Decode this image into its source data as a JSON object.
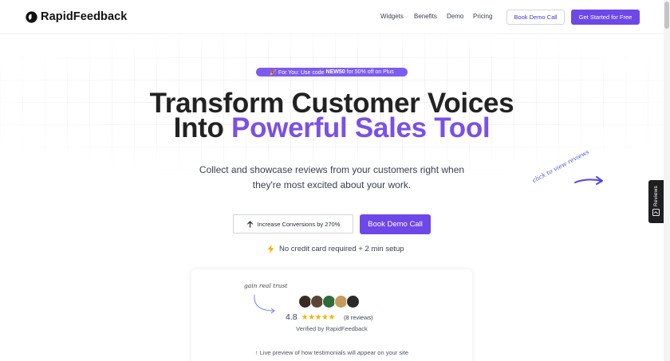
{
  "header": {
    "brand": "RapidFeedback",
    "nav": [
      "Widgets",
      "Benefits",
      "Demo",
      "Pricing"
    ],
    "book_demo": "Book Demo Call",
    "get_started": "Get Started for Free"
  },
  "promo": {
    "prefix": "🎉 For You: Use code",
    "code": "NEW50",
    "suffix": "for 50% off on Plus"
  },
  "hero": {
    "line1": "Transform Customer Voices",
    "line2_plain": "Into",
    "line2_accent": "Powerful Sales Tool",
    "sub1": "Collect and showcase reviews from your customers right when",
    "sub2": "they're most excited about your work."
  },
  "doodle": "click to view reviews",
  "reviews_tab": "Reviews",
  "cta": {
    "conversions": "Increase Conversions by 270%",
    "book_demo": "Book Demo Call",
    "no_card": "No credit card required + 2 min setup"
  },
  "card": {
    "tagline": "gain real trust",
    "rating": "4.8",
    "stars": "★★★★★",
    "count": "(8 reviews)",
    "verified": "Verified by RapidFeedback",
    "live_preview": "↑ Live preview of how testimonials will appear on your site"
  },
  "colors": {
    "accent": "#7a50e6",
    "primary_button": "#6e47e8",
    "star": "#f4b400"
  }
}
